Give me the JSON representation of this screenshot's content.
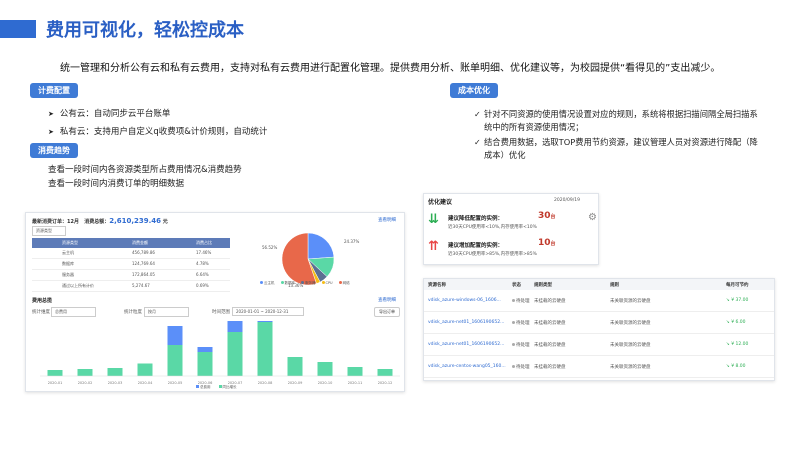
{
  "title": "费用可视化，轻松控成本",
  "intro": "统一管理和分析公有云和私有云费用，支持对私有云费用进行配置化管理。提供费用分析、账单明细、优化建议等，为校园提供“看得见的”支出减少。",
  "sections": {
    "cost_config": {
      "label": "计费配置",
      "items": [
        "公有云：自动同步云平台账单",
        "私有云：支持用户自定义q收费项&计价规则，自动统计"
      ]
    },
    "consume_trend": {
      "label": "消费趋势",
      "lines": [
        "查看一段时间内各资源类型所占费用情况&消费趋势",
        "查看一段时间内消费订单的明细数据"
      ]
    },
    "cost_optimize": {
      "label": "成本优化",
      "items": [
        "针对不同资源的使用情况设置对应的规则，系统将根据扫描间隔全局扫描系统中的所有资源使用情况；",
        "结合费用数据，选取TOP费用节约资源，建议管理人员对资源进行降配（降成本）优化"
      ]
    }
  },
  "dashboard": {
    "order_label": "最新消费订单：12月",
    "total_label": "消费总额：",
    "total_value": "2,610,239.46",
    "total_unit": "元",
    "more": "查看明细",
    "type_select": "资源类型",
    "table_headers": [
      "资源类型",
      "消费金额",
      "消费占比"
    ],
    "table_rows": [
      [
        "云主机",
        "456,789.86",
        "17.46%"
      ],
      [
        "数据库",
        "124,769.64",
        "4.78%"
      ],
      [
        "服务器",
        "172,864.05",
        "6.64%"
      ],
      [
        "通过以上所有计价",
        "5,274.67",
        "0.69%"
      ]
    ],
    "pie_labels": [
      "56.52%",
      "24.37%",
      "13.36%"
    ],
    "pie_legend": [
      "云主机",
      "数据库",
      "服务器",
      "CPU",
      "网络"
    ],
    "pie_colors": [
      "#5b8ff9",
      "#5ad8a6",
      "#5d7092",
      "#f6bd16",
      "#e8684a"
    ],
    "pie_values": [
      24.37,
      13.36,
      5.5,
      2.5,
      56.52
    ],
    "trend_title": "费用总揽",
    "trend_more": "查看明细",
    "filter_label_1": "统计维度",
    "filter_value_1": "总费用",
    "filter_label_2": "统计粒度",
    "filter_value_2": "按月",
    "filter_label_3": "时间范围",
    "filter_value_3": "2020-01-01 ~ 2020-12-31",
    "export_button": "导出订单",
    "bar_legend": [
      "总费用",
      "同比增长"
    ],
    "chart_data": {
      "type": "bar",
      "categories": [
        "2020-01",
        "2020-02",
        "2020-03",
        "2020-04",
        "2020-05",
        "2020-06",
        "2020-07",
        "2020-08",
        "2020-09",
        "2020-10",
        "2020-11",
        "2020-12"
      ],
      "series": [
        {
          "values": [
            12,
            14,
            16,
            25,
            62,
            48,
            88,
            108,
            38,
            28,
            18,
            14
          ],
          "color": "#5ad8a6"
        },
        {
          "values": [
            0,
            0,
            0,
            0,
            38,
            10,
            40,
            50,
            0,
            0,
            0,
            0
          ],
          "color": "#5b8ff9"
        }
      ]
    }
  },
  "optimize_panel": {
    "title": "优化建议",
    "date": "2020/09/19",
    "rows": [
      {
        "label": "建议降低配置的实例：",
        "count": "30",
        "unit": "台",
        "sub": "近30天CPU使用率<10%,内存使用率<10%",
        "color": "#2dae54"
      },
      {
        "label": "建议增加配置的实例：",
        "count": "10",
        "unit": "台",
        "sub": "近30天CPU使用率>85%,内存使用率>85%",
        "color": "#e84545"
      }
    ]
  },
  "resource_panel": {
    "headers": [
      "资源名称",
      "状态",
      "规则类型",
      "规则",
      "每月可节约"
    ],
    "rows": [
      {
        "name": "vdisk_azure-windows-06_1606...",
        "status": "待处理",
        "type": "未挂载的云硬盘",
        "rule": "未关联资源的云硬盘",
        "saving": "¥ 37.00"
      },
      {
        "name": "vdisk_azure-net01_1606190652...",
        "status": "待处理",
        "type": "未挂载的云硬盘",
        "rule": "未关联资源的云硬盘",
        "saving": "¥ 6.00"
      },
      {
        "name": "vdisk_azure-net01_1606190652...",
        "status": "待处理",
        "type": "未挂载的云硬盘",
        "rule": "未关联资源的云硬盘",
        "saving": "¥ 12.00"
      },
      {
        "name": "vdisk_azure-centos-wang05_160...",
        "status": "待处理",
        "type": "未挂载的云硬盘",
        "rule": "未关联资源的云硬盘",
        "saving": "¥ 8.00"
      }
    ]
  }
}
